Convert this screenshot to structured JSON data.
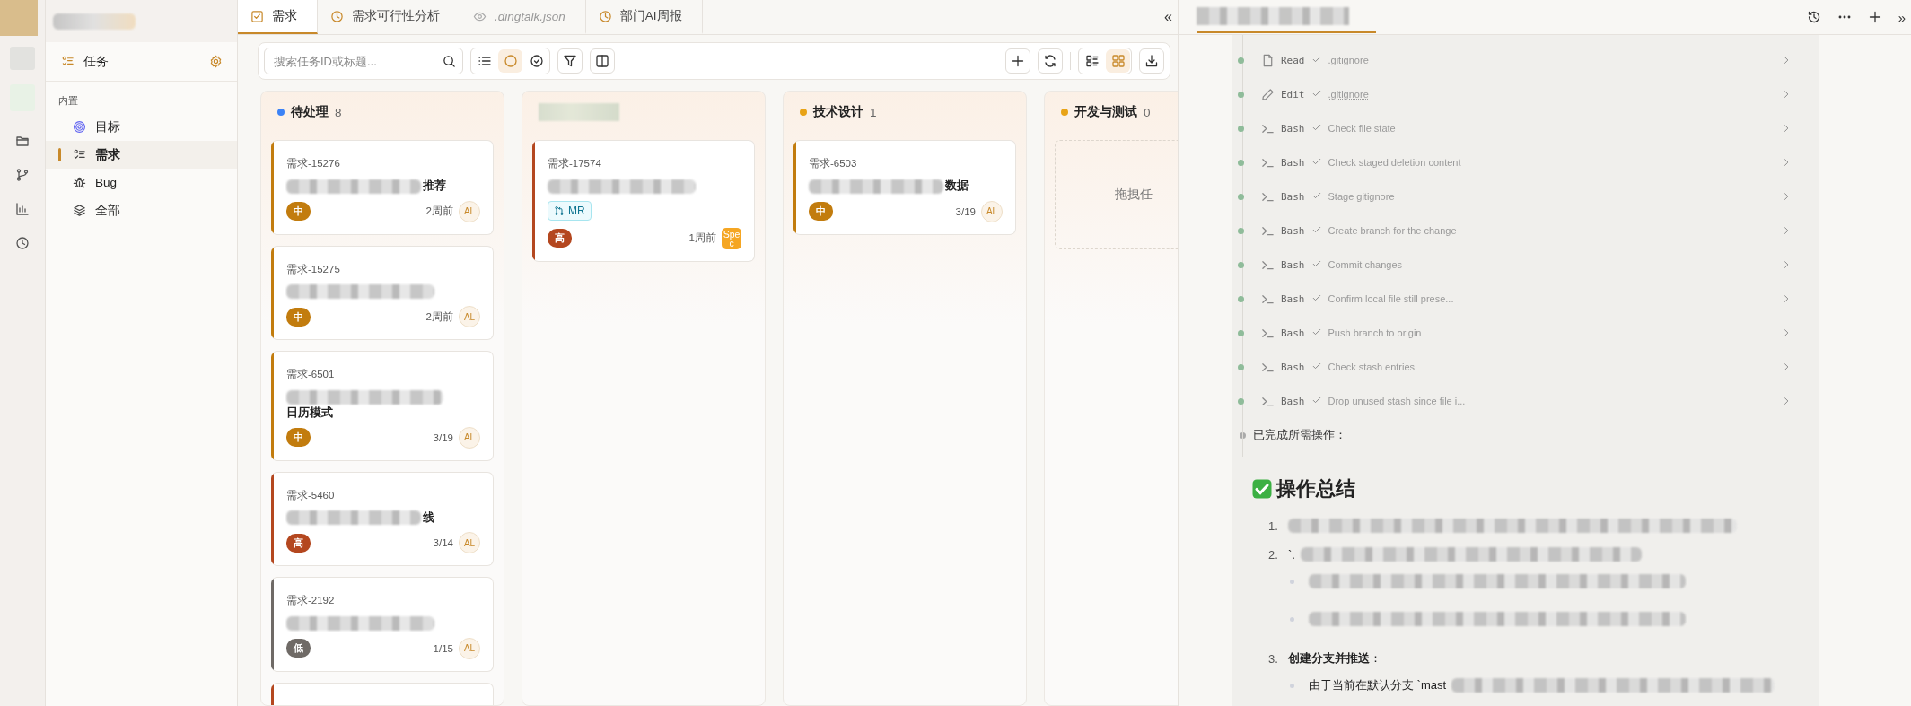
{
  "sidebar": {
    "header": "任务",
    "section": "内置",
    "items": [
      {
        "label": "目标",
        "kind": "target",
        "selected": false
      },
      {
        "label": "需求",
        "kind": "requirement",
        "selected": true
      },
      {
        "label": "Bug",
        "kind": "bug",
        "selected": false
      },
      {
        "label": "全部",
        "kind": "layers",
        "selected": false
      }
    ]
  },
  "tabs": [
    {
      "label": "需求",
      "kind": "task",
      "selected": true
    },
    {
      "label": "需求可行性分析",
      "kind": "clock",
      "selected": false
    },
    {
      "label": ".dingtalk.json",
      "kind": "preview",
      "selected": false
    },
    {
      "label": "部门AI周报",
      "kind": "clock",
      "selected": false
    }
  ],
  "collapse_left": "«",
  "toolbar": {
    "search": {
      "placeholder": "搜索任务ID或标题..."
    },
    "view_modes": [
      {
        "kind": "list",
        "selected": false
      },
      {
        "kind": "pending",
        "selected": true
      },
      {
        "kind": "done",
        "selected": false
      }
    ],
    "layouts": [
      {
        "kind": "list",
        "selected": false
      },
      {
        "kind": "grid",
        "selected": true
      }
    ]
  },
  "columns": [
    {
      "title": "待处理",
      "count": "8",
      "color": "#3b82f6",
      "cards": [
        {
          "id": "需求-15276",
          "title_blurred": true,
          "title": "推荐",
          "priority": "中",
          "color": "#c27c0e",
          "time": "2周前",
          "assignee": "AL"
        },
        {
          "id": "需求-15275",
          "title_blurred": true,
          "priority": "中",
          "color": "#c27c0e",
          "time": "2周前",
          "assignee": "AL"
        },
        {
          "id": "需求-6501",
          "title_blurred": true,
          "title": "日历模式",
          "priority": "中",
          "color": "#c27c0e",
          "time": "3/19",
          "assignee": "AL"
        },
        {
          "id": "需求-5460",
          "title_blurred": true,
          "title": "线",
          "priority": "高",
          "color": "#b4471f",
          "time": "3/14",
          "assignee": "AL"
        },
        {
          "id": "需求-2192",
          "title_blurred": true,
          "priority": "低",
          "color": "#6f6a66",
          "time": "1/15",
          "assignee": "AL"
        },
        {
          "color": "#b4471f"
        }
      ]
    },
    {
      "title_blurred": true,
      "cards": [
        {
          "id": "需求-17574",
          "title_blurred": true,
          "tag": "MR",
          "priority": "高",
          "color": "#b4471f",
          "time": "1周前",
          "badge": "Spec"
        }
      ]
    },
    {
      "title": "技术设计",
      "count": "1",
      "color": "#e8a317",
      "cards": [
        {
          "id": "需求-6503",
          "title_blurred": true,
          "title": "数据",
          "priority": "中",
          "color": "#c27c0e",
          "time": "3/19",
          "assignee": "AL"
        }
      ]
    },
    {
      "title": "开发与测试",
      "count": "0",
      "color": "#e8a317",
      "drop_hint": "拖拽任"
    }
  ],
  "agent_panel": {
    "expand_right": "»",
    "steps": [
      {
        "tool": "Read",
        "kind": "file",
        "detail": ".gitignore",
        "underlined": true
      },
      {
        "tool": "Edit",
        "kind": "edit",
        "detail": ".gitignore",
        "underlined": true
      },
      {
        "tool": "Bash",
        "kind": "terminal",
        "detail": "Check file state",
        "underlined": false
      },
      {
        "tool": "Bash",
        "kind": "terminal",
        "detail": "Check staged deletion content",
        "underlined": false
      },
      {
        "tool": "Bash",
        "kind": "terminal",
        "detail": "Stage gitignore",
        "underlined": false
      },
      {
        "tool": "Bash",
        "kind": "terminal",
        "detail": "Create branch for the change",
        "underlined": false
      },
      {
        "tool": "Bash",
        "kind": "terminal",
        "detail": "Commit changes",
        "underlined": false
      },
      {
        "tool": "Bash",
        "kind": "terminal",
        "detail": "Confirm local file still prese...",
        "underlined": false
      },
      {
        "tool": "Bash",
        "kind": "terminal",
        "detail": "Push branch to origin",
        "underlined": false
      },
      {
        "tool": "Bash",
        "kind": "terminal",
        "detail": "Check stash entries",
        "underlined": false
      },
      {
        "tool": "Bash",
        "kind": "terminal",
        "detail": "Drop unused stash since file i...",
        "underlined": false
      }
    ],
    "message": "已完成所需操作：",
    "heading": "操作总结",
    "summary": [
      {
        "number": "1.",
        "blurred": true
      },
      {
        "number": "2.",
        "text": "`.",
        "blurred": true,
        "children": [
          {
            "blurred": true
          },
          {
            "blurred": true
          }
        ]
      },
      {
        "number": "3.",
        "text": "**创建分支并推送**：",
        "blurred": false,
        "children": [
          {
            "text": "由于当前在默认分支 `mast",
            "blurred": true
          }
        ]
      }
    ]
  }
}
